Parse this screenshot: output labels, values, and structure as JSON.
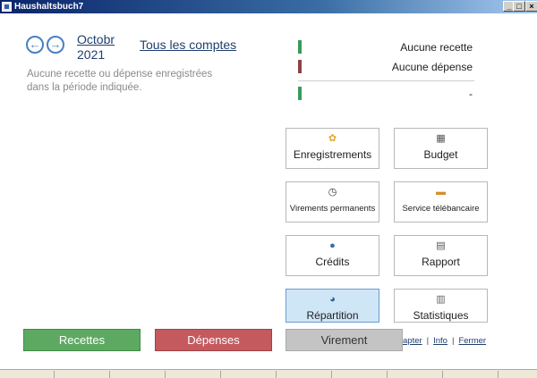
{
  "window": {
    "title": "Haushaltsbuch7",
    "min_label": "_",
    "max_label": "□",
    "close_label": "×"
  },
  "nav": {
    "prev_glyph": "←",
    "next_glyph": "→",
    "month": "Octobr",
    "year": "2021",
    "accounts_link": "Tous les comptes"
  },
  "message": "Aucune recette ou dépense enregistrées dans la période indiquée.",
  "summary": {
    "income": "Aucune recette",
    "expense": "Aucune dépense",
    "balance": "-",
    "colors": {
      "income": "#3a9a5a",
      "expense": "#8b4444"
    }
  },
  "tiles": [
    {
      "label": "Enregistrements",
      "icon": "coins-icon",
      "glyph": "✿",
      "color": "#e0a92a"
    },
    {
      "label": "Budget",
      "icon": "calculator-icon",
      "glyph": "▦",
      "color": "#555555"
    },
    {
      "label": "Virements permanents",
      "icon": "clock-icon",
      "glyph": "◷",
      "color": "#333333"
    },
    {
      "label": "Service télébancaire",
      "icon": "bank-card-icon",
      "glyph": "▬",
      "color": "#d98c2b"
    },
    {
      "label": "Crédits",
      "icon": "person-icon",
      "glyph": "●",
      "color": "#2f6fb3"
    },
    {
      "label": "Rapport",
      "icon": "report-icon",
      "glyph": "▤",
      "color": "#555555"
    },
    {
      "label": "Répartition",
      "icon": "pie-chart-icon",
      "glyph": "◕",
      "color": "#2f5f9a"
    },
    {
      "label": "Statistiques",
      "icon": "bar-chart-icon",
      "glyph": "▥",
      "color": "#666666"
    }
  ],
  "selected_tile": "Répartition",
  "buttons": {
    "income": "Recettes",
    "expense": "Dépenses",
    "transfer": "Virement"
  },
  "footer": {
    "adapt": "apter",
    "info": "Info",
    "close": "Fermer",
    "sep": "|"
  }
}
